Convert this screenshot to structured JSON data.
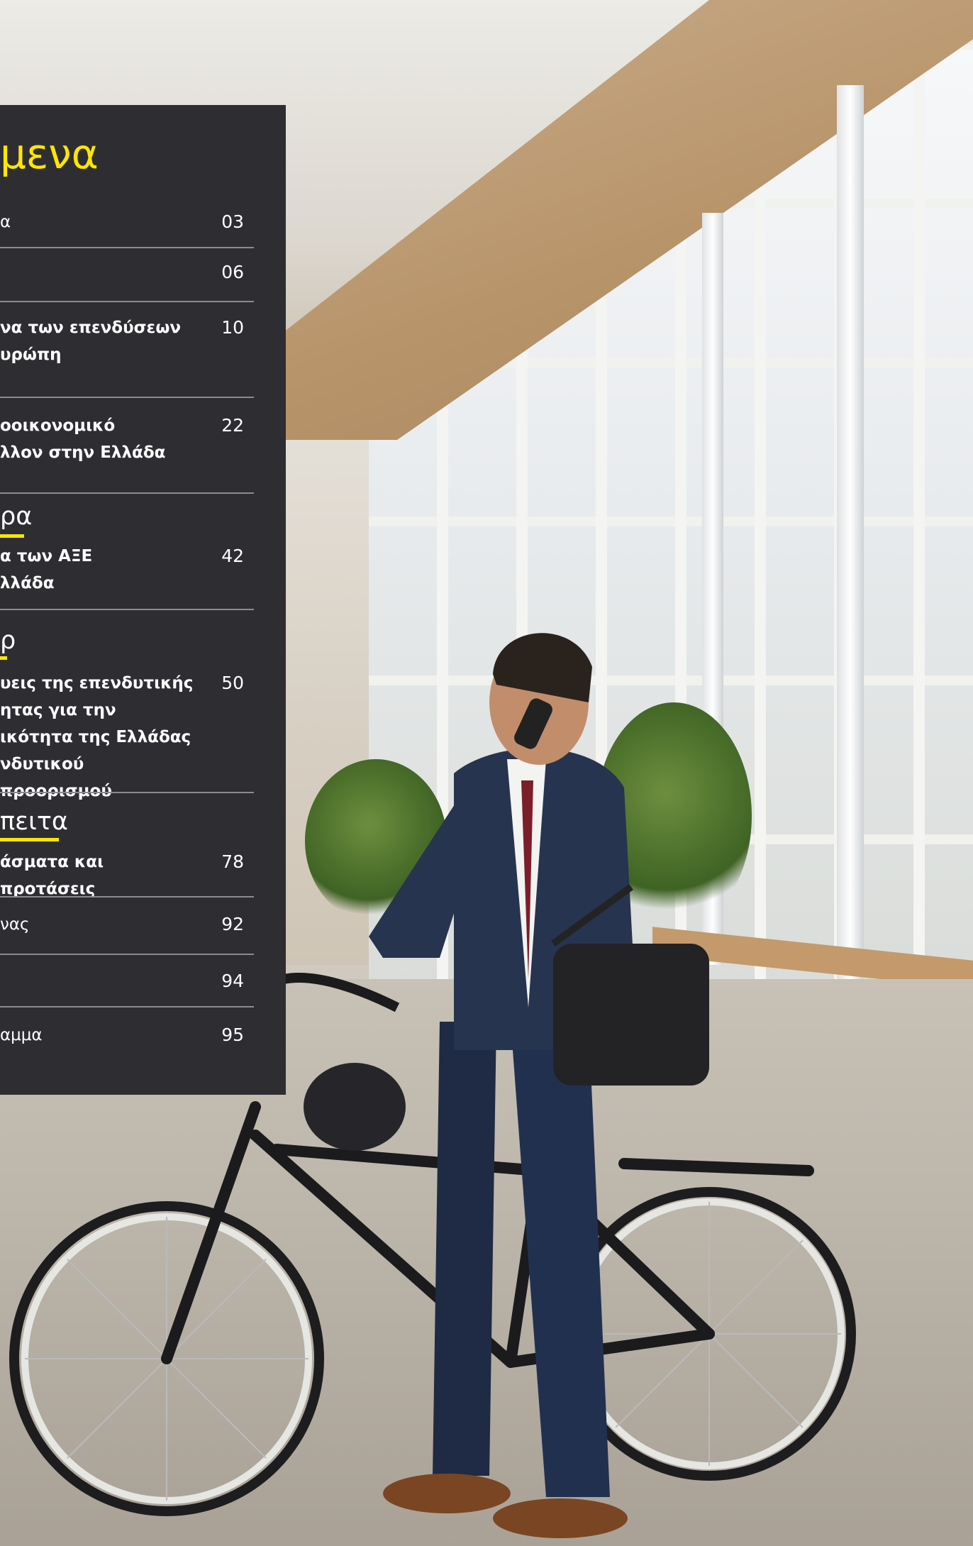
{
  "contents": {
    "title": "μενα",
    "entries": [
      {
        "text": "α",
        "page": "03",
        "bold": false
      },
      {
        "text": "",
        "page": "06",
        "bold": false
      },
      {
        "text": "να των επενδύσεων\nυρώπη",
        "page": "10",
        "bold": true
      },
      {
        "text": "οοικονομικό\nλλον στην Ελλάδα",
        "page": "22",
        "bold": true
      },
      {
        "text": "α των ΑΞΕ\nλλάδα",
        "page": "42",
        "bold": true
      },
      {
        "text": "υεις της επενδυτικής\nητας για την\nικότητα της Ελλάδας\nνδυτικού προορισμού",
        "page": "50",
        "bold": true
      },
      {
        "text": "άσματα και προτάσεις",
        "page": "78",
        "bold": true
      },
      {
        "text": "νας",
        "page": "92",
        "bold": false
      },
      {
        "text": "",
        "page": "94",
        "bold": false
      },
      {
        "text": "αμμα",
        "page": "95",
        "bold": false
      }
    ],
    "sections": [
      {
        "label": "ρα"
      },
      {
        "label": "ρ"
      },
      {
        "label": "πειτα"
      }
    ]
  },
  "colors": {
    "panel": "#2e2e32",
    "accent": "#ffe600",
    "text": "#ffffff",
    "rule": "#8c8c90"
  }
}
